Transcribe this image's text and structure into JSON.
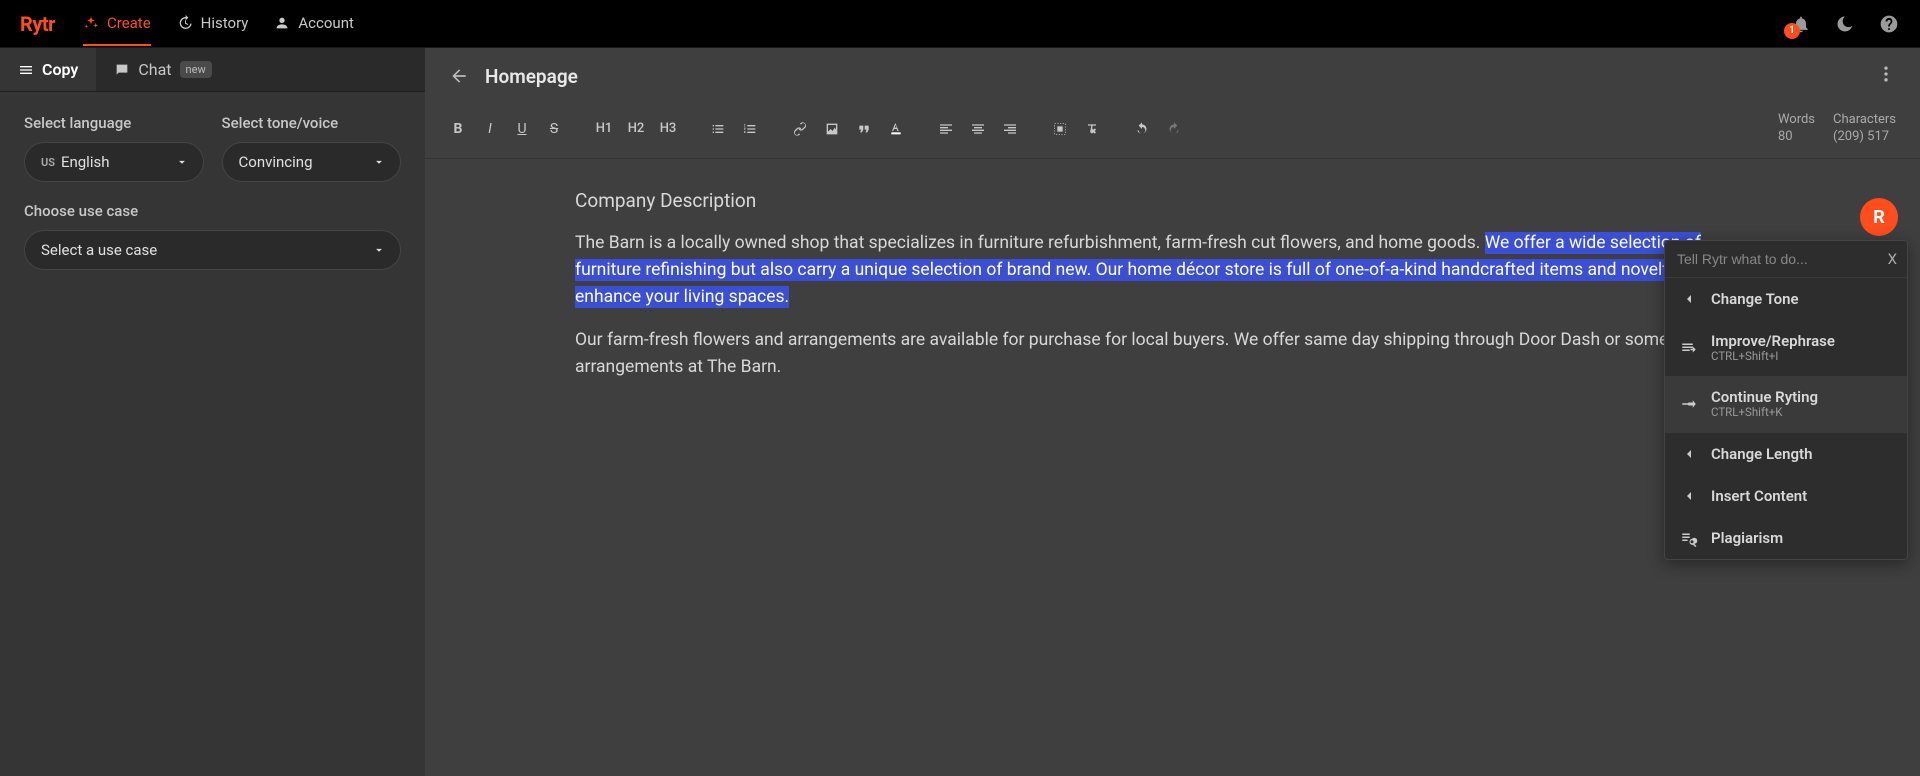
{
  "brand": "Rytr",
  "nav": {
    "create": "Create",
    "history": "History",
    "account": "Account",
    "notif_count": "1"
  },
  "sidebar": {
    "tab_copy": "Copy",
    "tab_chat": "Chat",
    "chat_badge": "new",
    "lang_label": "Select language",
    "lang_value": "English",
    "lang_prefix": "US",
    "tone_label": "Select tone/voice",
    "tone_value": "Convincing",
    "usecase_label": "Choose use case",
    "usecase_value": "Select a use case"
  },
  "editor": {
    "doc_title": "Homepage",
    "words_label": "Words",
    "words_value": "80",
    "chars_label": "Characters",
    "chars_value": "(209) 517",
    "heading": "Company Description",
    "p1_pre": "The Barn is a locally owned shop that specializes in furniture refurbishment, farm-fresh cut flowers, and home goods. ",
    "p1_hl": "We offer a wide selection of furniture refinishing but also carry a unique selection of brand new. Our home décor store is full of one-of-a-kind handcrafted items and novelties that enhance your living spaces.",
    "p2": "Our farm-fresh flowers and arrangements are available for purchase for local buyers. We offer same day shipping through Door Dash or some Pick-up arrangements at The Barn.",
    "avatar": "R"
  },
  "toolbar": {
    "h1": "H1",
    "h2": "H2",
    "h3": "H3"
  },
  "ctx": {
    "placeholder": "Tell Rytr what to do...",
    "close": "X",
    "change_tone": "Change Tone",
    "improve": "Improve/Rephrase",
    "improve_sub": "CTRL+Shift+I",
    "continue": "Continue Ryting",
    "continue_sub": "CTRL+Shift+K",
    "change_length": "Change Length",
    "insert": "Insert Content",
    "plagiarism": "Plagiarism"
  }
}
